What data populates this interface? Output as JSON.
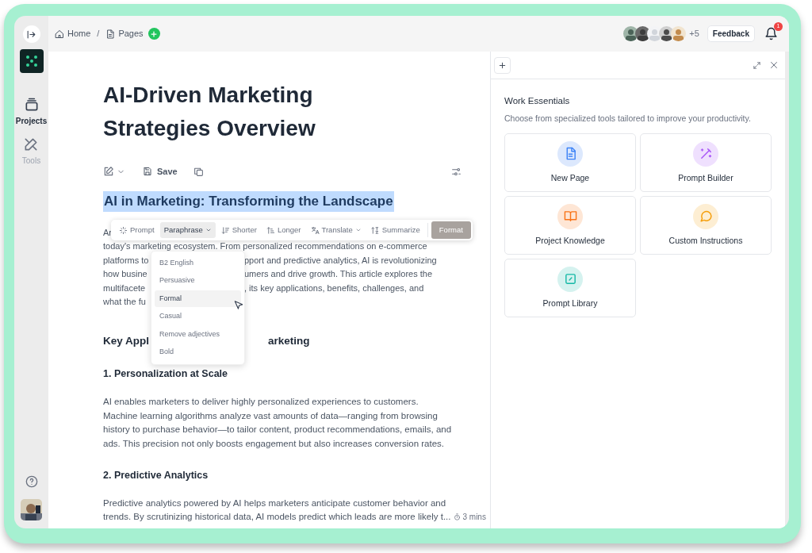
{
  "rail": {
    "nav": [
      {
        "label": "Projects",
        "kind": "stack",
        "selected": true
      },
      {
        "label": "Tools",
        "kind": "tools",
        "selected": false
      }
    ]
  },
  "breadcrumb": [
    "Home",
    "Pages"
  ],
  "breadcrumb_separator": "/",
  "collaborators": {
    "more": "+5"
  },
  "feedback": "Feedback",
  "notifications": {
    "count": "1"
  },
  "doc": {
    "title": "AI-Driven Marketing Strategies Overview",
    "save": "Save",
    "heading": {
      "text": "AI in Marketing: Transforming the Landscape",
      "selected": true
    },
    "intro": [
      {
        "left": "Ar"
      },
      {
        "left": "today's marketing ecosystem. From personalized recommendations on e-commerce"
      },
      {
        "left": "platforms to",
        "right": "pport and predictive analytics, AI is revolutionizing"
      },
      {
        "left": "how busine",
        "right": "umers and drive growth. This article explores the"
      },
      {
        "left": "multifacete",
        "right": ", its key applications, benefits, challenges, and"
      },
      {
        "left": "what the fu"
      }
    ],
    "section_heading": {
      "left": "Key Appl",
      "right": "arketing"
    },
    "sections": [
      {
        "title": "1. Personalization at Scale",
        "lines": [
          "AI enables marketers to deliver highly personalized experiences to customers.",
          "Machine learning algorithms analyze vast amounts of data—ranging from browsing",
          "history to purchase behavior—to tailor content, product recommendations, emails, and",
          "ads. This precision not only boosts engagement but also increases conversion rates."
        ]
      },
      {
        "title": "2. Predictive Analytics",
        "lines": [
          "Predictive analytics powered by AI helps marketers anticipate customer behavior and",
          "trends. By scrutinizing historical data, AI models predict which leads are more likely t..."
        ]
      }
    ],
    "reading_time": "3 mins"
  },
  "ai_toolbar": [
    {
      "label": "Prompt",
      "kind": "sparkle",
      "selected": false
    },
    {
      "label": "Paraphrase",
      "kind": "dropdown",
      "selected": true
    },
    {
      "label": "Shorter",
      "kind": "shorter",
      "selected": false
    },
    {
      "label": "Longer",
      "kind": "longer",
      "selected": false
    },
    {
      "label": "Translate",
      "kind": "translate",
      "selected": false
    },
    {
      "label": "Summarize",
      "kind": "summarize",
      "selected": false
    },
    {
      "label": "Format",
      "kind": "primary",
      "selected": false
    }
  ],
  "paraphrase_menu": [
    {
      "label": "B2 English",
      "selected": false
    },
    {
      "label": "Persuasive",
      "selected": false
    },
    {
      "label": "Formal",
      "selected": true
    },
    {
      "label": "Casual",
      "selected": false
    },
    {
      "label": "Remove adjectives",
      "selected": false
    },
    {
      "label": "Bold",
      "selected": false
    }
  ],
  "panel": {
    "title": "Work Essentials",
    "subtitle": "Choose from specialized tools tailored to improve your productivity.",
    "cards": [
      {
        "label": "New Page",
        "kind": "page",
        "color": "#3b82f6"
      },
      {
        "label": "Prompt Builder",
        "kind": "wand",
        "color": "#a855f7"
      },
      {
        "label": "Project Knowledge",
        "kind": "book",
        "color": "#f97316"
      },
      {
        "label": "Custom Instructions",
        "kind": "chat",
        "color": "#f59e0b"
      },
      {
        "label": "Prompt Library",
        "kind": "edit",
        "color": "#14b8a6"
      }
    ]
  }
}
